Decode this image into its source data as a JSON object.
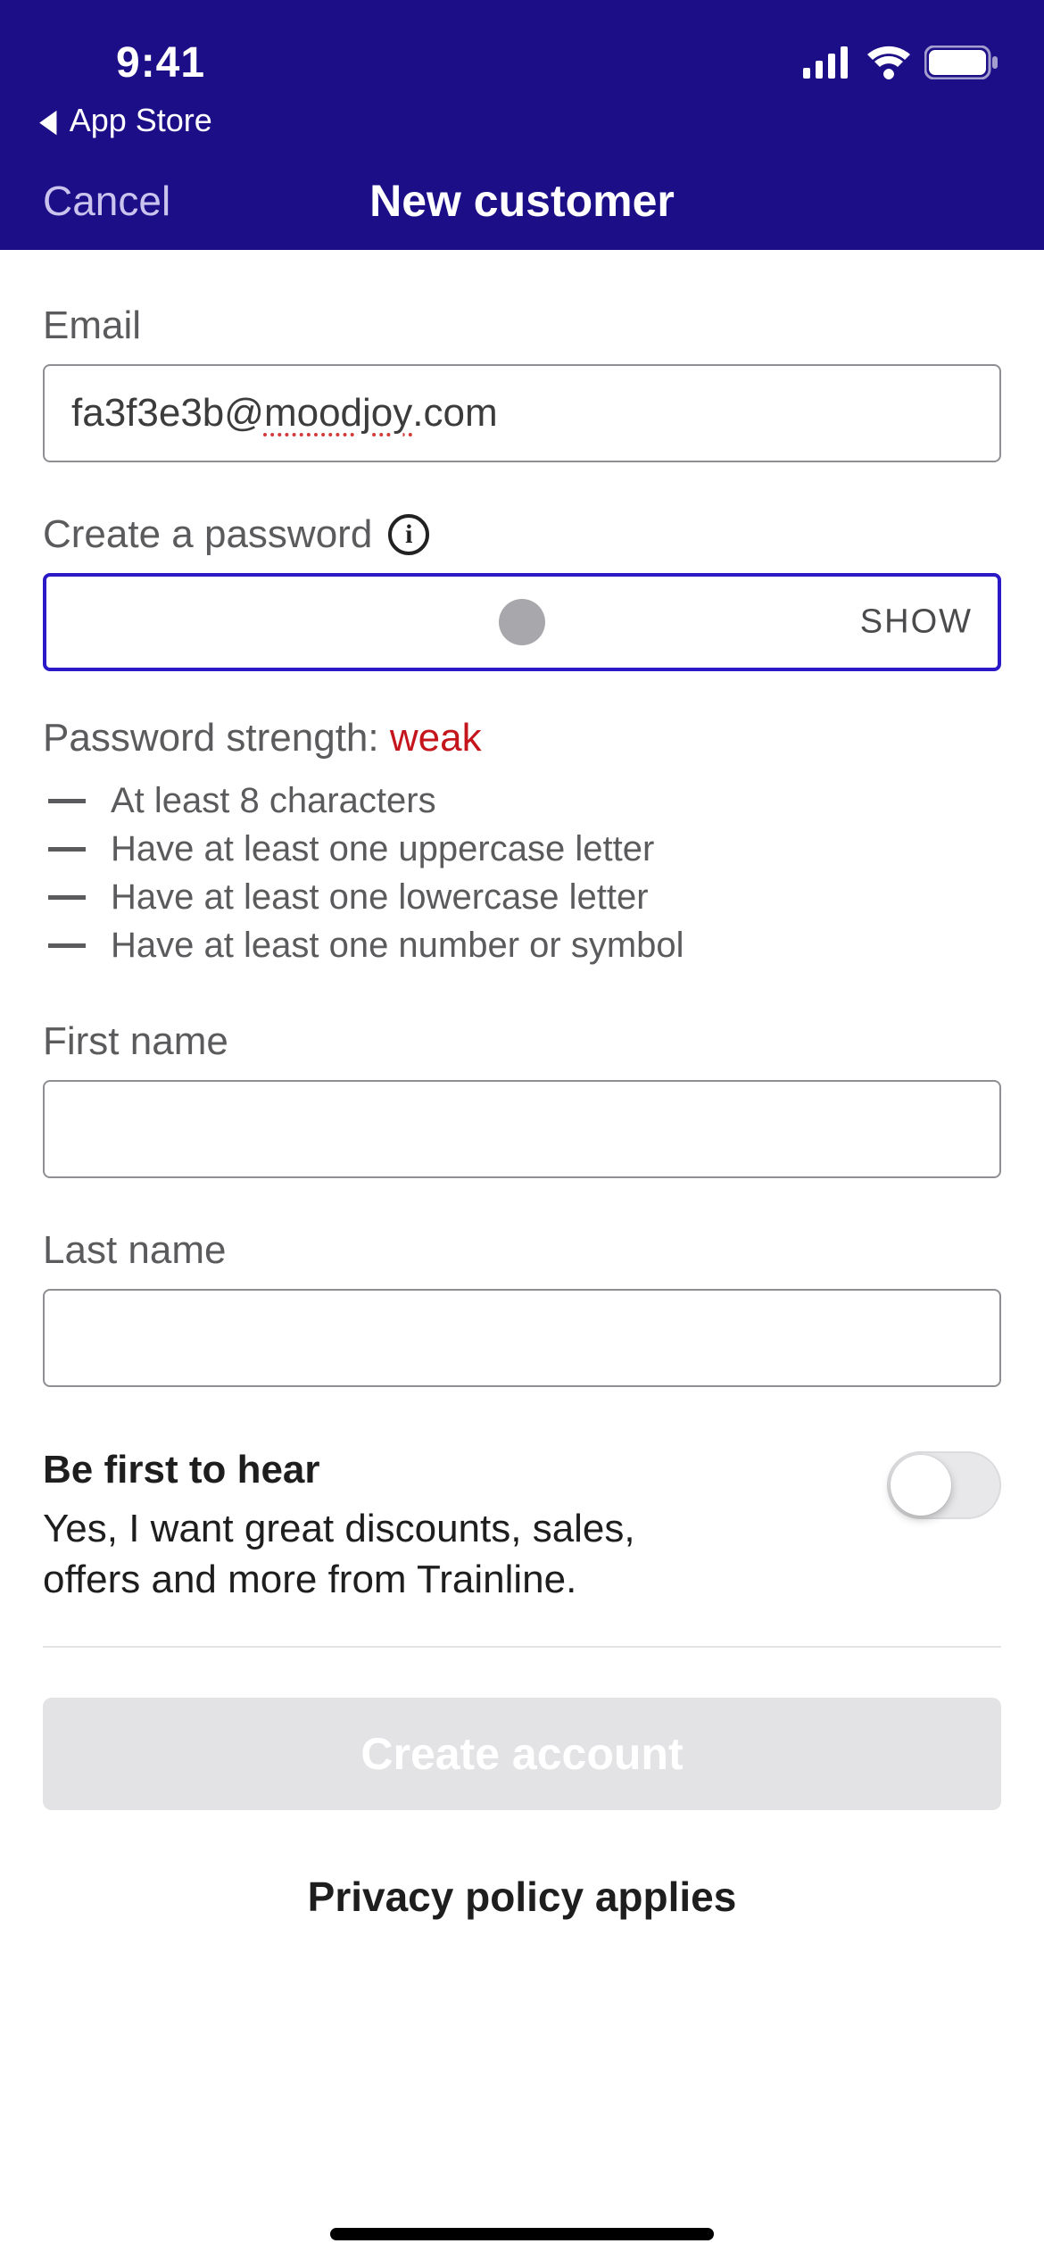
{
  "statusbar": {
    "time": "9:41",
    "breadcrumb": "App Store"
  },
  "nav": {
    "cancel": "Cancel",
    "title": "New customer"
  },
  "form": {
    "email_label": "Email",
    "email_value_pre": "fa3f3e3b@",
    "email_value_mid": "moodjoy",
    "email_value_post": ".com",
    "password_label": "Create a password",
    "show_label": "SHOW",
    "strength_prefix": "Password strength: ",
    "strength_value": "weak",
    "rules": {
      "r1": "At least 8 characters",
      "r2": "Have at least one uppercase letter",
      "r3": "Have at least one lowercase letter",
      "r4": "Have at least one number or symbol"
    },
    "first_name_label": "First name",
    "first_name_value": "",
    "last_name_label": "Last name",
    "last_name_value": ""
  },
  "marketing": {
    "title": "Be first to hear",
    "desc": "Yes, I want great discounts, sales, offers and more from Trainline."
  },
  "footer": {
    "create": "Create account",
    "privacy": "Privacy policy applies"
  }
}
